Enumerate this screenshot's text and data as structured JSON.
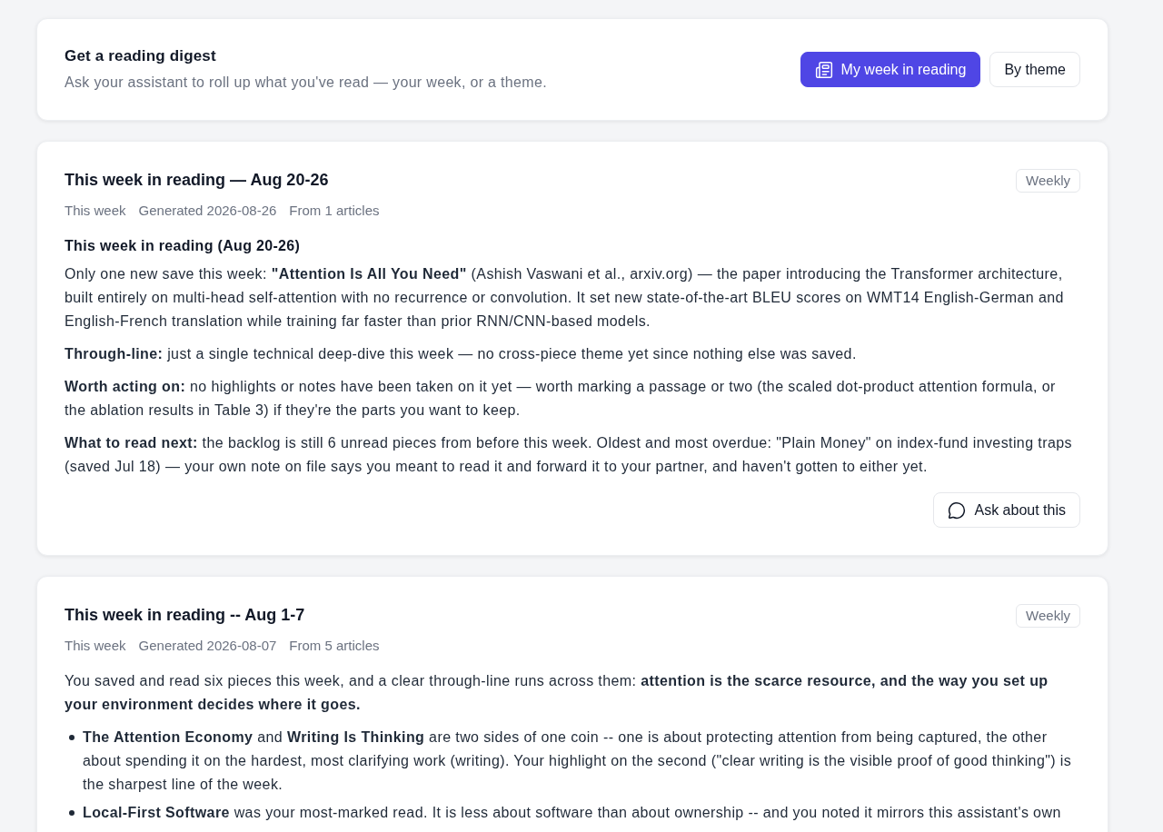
{
  "digest_prompt": {
    "title": "Get a reading digest",
    "subtitle": "Ask your assistant to roll up what you've read — your week, or a theme.",
    "buttons": [
      {
        "label": "My week in reading",
        "kind": "primary"
      },
      {
        "label": "By theme",
        "kind": "secondary"
      }
    ]
  },
  "digests": [
    {
      "title": "This week in reading — Aug 20-26",
      "badge": "Weekly",
      "meta": [
        "This week",
        "Generated 2026-08-26",
        "From 1 articles"
      ],
      "blocks": [
        {
          "kind": "heading",
          "text": "This week in reading (Aug 20-26)"
        },
        {
          "kind": "paragraph",
          "text": "Only one new save this week: **\"Attention Is All You Need\"** (Ashish Vaswani et al., arxiv.org) — the paper introducing the Transformer architecture, built entirely on multi-head self-attention with no recurrence or convolution. It set new state-of-the-art BLEU scores on WMT14 English-German and English-French translation while training far faster than prior RNN/CNN-based models."
        },
        {
          "kind": "paragraph",
          "text": "**Through-line:** just a single technical deep-dive this week — no cross-piece theme yet since nothing else was saved."
        },
        {
          "kind": "paragraph",
          "text": "**Worth acting on:** no highlights or notes have been taken on it yet — worth marking a passage or two (the scaled dot-product attention formula, or the ablation results in Table 3) if they're the parts you want to keep."
        },
        {
          "kind": "paragraph",
          "text": "**What to read next:** the backlog is still 6 unread pieces from before this week. Oldest and most overdue: \"Plain Money\" on index-fund investing traps (saved Jul 18) — your own note on file says you meant to read it and forward it to your partner, and haven't gotten to either yet."
        }
      ],
      "action": {
        "label": "Ask about this"
      }
    },
    {
      "title": "This week in reading -- Aug 1-7",
      "badge": "Weekly",
      "meta": [
        "This week",
        "Generated 2026-08-07",
        "From 5 articles"
      ],
      "blocks": [
        {
          "kind": "paragraph",
          "text": "You saved and read six pieces this week, and a clear through-line runs across them: **attention is the scarce resource, and the way you set up your environment decides where it goes.**"
        },
        {
          "kind": "list",
          "items": [
            "**The Attention Economy** and **Writing Is Thinking** are two sides of one coin -- one is about protecting attention from being captured, the other about spending it on the hardest, most clarifying work (writing). Your highlight on the second (\"clear writing is the visible proof of good thinking\") is the sharpest line of the week.",
            "**Local-First Software** was your most-marked read. It is less about software than about ownership -- and you noted it mirrors this assistant's own"
          ]
        }
      ]
    }
  ]
}
